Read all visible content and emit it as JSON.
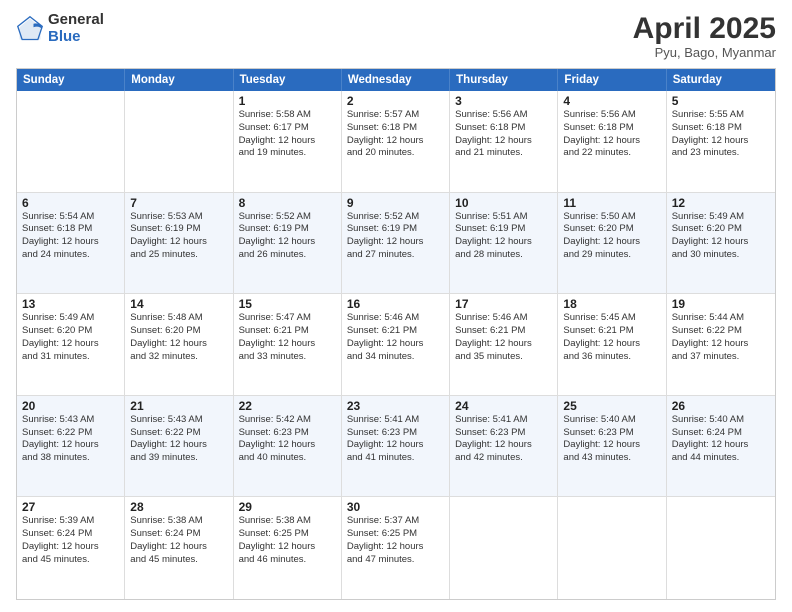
{
  "logo": {
    "general": "General",
    "blue": "Blue"
  },
  "title": "April 2025",
  "subtitle": "Pyu, Bago, Myanmar",
  "weekdays": [
    "Sunday",
    "Monday",
    "Tuesday",
    "Wednesday",
    "Thursday",
    "Friday",
    "Saturday"
  ],
  "weeks": [
    [
      {
        "day": "",
        "info": ""
      },
      {
        "day": "",
        "info": ""
      },
      {
        "day": "1",
        "info": "Sunrise: 5:58 AM\nSunset: 6:17 PM\nDaylight: 12 hours\nand 19 minutes."
      },
      {
        "day": "2",
        "info": "Sunrise: 5:57 AM\nSunset: 6:18 PM\nDaylight: 12 hours\nand 20 minutes."
      },
      {
        "day": "3",
        "info": "Sunrise: 5:56 AM\nSunset: 6:18 PM\nDaylight: 12 hours\nand 21 minutes."
      },
      {
        "day": "4",
        "info": "Sunrise: 5:56 AM\nSunset: 6:18 PM\nDaylight: 12 hours\nand 22 minutes."
      },
      {
        "day": "5",
        "info": "Sunrise: 5:55 AM\nSunset: 6:18 PM\nDaylight: 12 hours\nand 23 minutes."
      }
    ],
    [
      {
        "day": "6",
        "info": "Sunrise: 5:54 AM\nSunset: 6:18 PM\nDaylight: 12 hours\nand 24 minutes."
      },
      {
        "day": "7",
        "info": "Sunrise: 5:53 AM\nSunset: 6:19 PM\nDaylight: 12 hours\nand 25 minutes."
      },
      {
        "day": "8",
        "info": "Sunrise: 5:52 AM\nSunset: 6:19 PM\nDaylight: 12 hours\nand 26 minutes."
      },
      {
        "day": "9",
        "info": "Sunrise: 5:52 AM\nSunset: 6:19 PM\nDaylight: 12 hours\nand 27 minutes."
      },
      {
        "day": "10",
        "info": "Sunrise: 5:51 AM\nSunset: 6:19 PM\nDaylight: 12 hours\nand 28 minutes."
      },
      {
        "day": "11",
        "info": "Sunrise: 5:50 AM\nSunset: 6:20 PM\nDaylight: 12 hours\nand 29 minutes."
      },
      {
        "day": "12",
        "info": "Sunrise: 5:49 AM\nSunset: 6:20 PM\nDaylight: 12 hours\nand 30 minutes."
      }
    ],
    [
      {
        "day": "13",
        "info": "Sunrise: 5:49 AM\nSunset: 6:20 PM\nDaylight: 12 hours\nand 31 minutes."
      },
      {
        "day": "14",
        "info": "Sunrise: 5:48 AM\nSunset: 6:20 PM\nDaylight: 12 hours\nand 32 minutes."
      },
      {
        "day": "15",
        "info": "Sunrise: 5:47 AM\nSunset: 6:21 PM\nDaylight: 12 hours\nand 33 minutes."
      },
      {
        "day": "16",
        "info": "Sunrise: 5:46 AM\nSunset: 6:21 PM\nDaylight: 12 hours\nand 34 minutes."
      },
      {
        "day": "17",
        "info": "Sunrise: 5:46 AM\nSunset: 6:21 PM\nDaylight: 12 hours\nand 35 minutes."
      },
      {
        "day": "18",
        "info": "Sunrise: 5:45 AM\nSunset: 6:21 PM\nDaylight: 12 hours\nand 36 minutes."
      },
      {
        "day": "19",
        "info": "Sunrise: 5:44 AM\nSunset: 6:22 PM\nDaylight: 12 hours\nand 37 minutes."
      }
    ],
    [
      {
        "day": "20",
        "info": "Sunrise: 5:43 AM\nSunset: 6:22 PM\nDaylight: 12 hours\nand 38 minutes."
      },
      {
        "day": "21",
        "info": "Sunrise: 5:43 AM\nSunset: 6:22 PM\nDaylight: 12 hours\nand 39 minutes."
      },
      {
        "day": "22",
        "info": "Sunrise: 5:42 AM\nSunset: 6:23 PM\nDaylight: 12 hours\nand 40 minutes."
      },
      {
        "day": "23",
        "info": "Sunrise: 5:41 AM\nSunset: 6:23 PM\nDaylight: 12 hours\nand 41 minutes."
      },
      {
        "day": "24",
        "info": "Sunrise: 5:41 AM\nSunset: 6:23 PM\nDaylight: 12 hours\nand 42 minutes."
      },
      {
        "day": "25",
        "info": "Sunrise: 5:40 AM\nSunset: 6:23 PM\nDaylight: 12 hours\nand 43 minutes."
      },
      {
        "day": "26",
        "info": "Sunrise: 5:40 AM\nSunset: 6:24 PM\nDaylight: 12 hours\nand 44 minutes."
      }
    ],
    [
      {
        "day": "27",
        "info": "Sunrise: 5:39 AM\nSunset: 6:24 PM\nDaylight: 12 hours\nand 45 minutes."
      },
      {
        "day": "28",
        "info": "Sunrise: 5:38 AM\nSunset: 6:24 PM\nDaylight: 12 hours\nand 45 minutes."
      },
      {
        "day": "29",
        "info": "Sunrise: 5:38 AM\nSunset: 6:25 PM\nDaylight: 12 hours\nand 46 minutes."
      },
      {
        "day": "30",
        "info": "Sunrise: 5:37 AM\nSunset: 6:25 PM\nDaylight: 12 hours\nand 47 minutes."
      },
      {
        "day": "",
        "info": ""
      },
      {
        "day": "",
        "info": ""
      },
      {
        "day": "",
        "info": ""
      }
    ]
  ]
}
